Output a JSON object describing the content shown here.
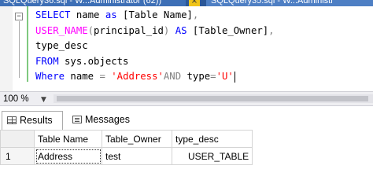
{
  "tabs": {
    "active_tab": "SQLQuery36.sql - W...Administrator (62))",
    "close_glyph": "×",
    "other_tab": "SQLQuery35.sql - W...Administr"
  },
  "editor": {
    "lines": [
      [
        {
          "t": "SELECT",
          "c": "kw"
        },
        {
          "t": " name ",
          "c": "tx"
        },
        {
          "t": "as",
          "c": "kw"
        },
        {
          "t": " [Table Name]",
          "c": "tx"
        },
        {
          "t": ",",
          "c": "gr"
        }
      ],
      [
        {
          "t": "USER_NAME",
          "c": "fn"
        },
        {
          "t": "(",
          "c": "gr"
        },
        {
          "t": "principal_id",
          "c": "tx"
        },
        {
          "t": ")",
          "c": "gr"
        },
        {
          "t": " AS ",
          "c": "kw"
        },
        {
          "t": "[Table_Owner]",
          "c": "tx"
        },
        {
          "t": ",",
          "c": "gr"
        }
      ],
      [
        {
          "t": "type_desc",
          "c": "tx"
        }
      ],
      [
        {
          "t": "FROM",
          "c": "kw"
        },
        {
          "t": " sys.objects",
          "c": "tx"
        }
      ],
      [
        {
          "t": "Where",
          "c": "kw"
        },
        {
          "t": " name ",
          "c": "tx"
        },
        {
          "t": "=",
          "c": "gr"
        },
        {
          "t": " ",
          "c": "tx"
        },
        {
          "t": "'Address'",
          "c": "st"
        },
        {
          "t": "AND",
          "c": "gr"
        },
        {
          "t": " type",
          "c": "tx"
        },
        {
          "t": "=",
          "c": "gr"
        },
        {
          "t": "'U'",
          "c": "st"
        }
      ]
    ]
  },
  "zoom": {
    "value": "100 %"
  },
  "results": {
    "tabs": {
      "results": "Results",
      "messages": "Messages"
    },
    "columns": [
      "Table Name",
      "Table_Owner",
      "type_desc"
    ],
    "rows": [
      {
        "num": "1",
        "cells": [
          "Address",
          "test",
          "USER_TABLE"
        ]
      }
    ]
  }
}
